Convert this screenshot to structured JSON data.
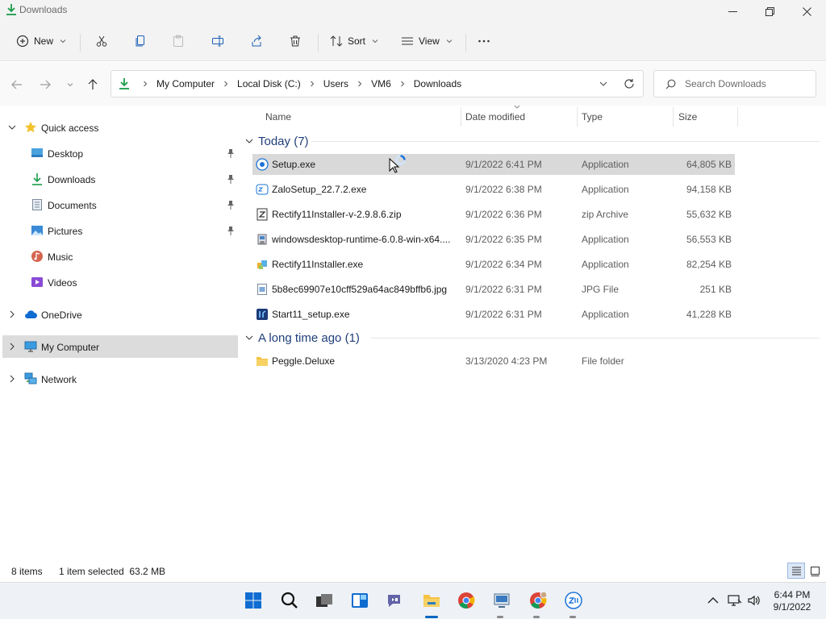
{
  "window": {
    "title": "Downloads"
  },
  "toolbar": {
    "new_label": "New",
    "sort_label": "Sort",
    "view_label": "View"
  },
  "address": {
    "crumbs": [
      "My Computer",
      "Local Disk (C:)",
      "Users",
      "VM6",
      "Downloads"
    ]
  },
  "search": {
    "placeholder": "Search Downloads"
  },
  "sidebar": {
    "quick_access": "Quick access",
    "items": [
      "Desktop",
      "Downloads",
      "Documents",
      "Pictures",
      "Music",
      "Videos"
    ],
    "onedrive": "OneDrive",
    "my_computer": "My Computer",
    "network": "Network"
  },
  "columns": {
    "name": "Name",
    "date": "Date modified",
    "type": "Type",
    "size": "Size"
  },
  "groups": {
    "today": "Today (7)",
    "long_ago": "A long time ago (1)"
  },
  "files": [
    {
      "name": "Setup.exe",
      "date": "9/1/2022 6:41 PM",
      "type": "Application",
      "size": "64,805 KB"
    },
    {
      "name": "ZaloSetup_22.7.2.exe",
      "date": "9/1/2022 6:38 PM",
      "type": "Application",
      "size": "94,158 KB"
    },
    {
      "name": "Rectify11Installer-v-2.9.8.6.zip",
      "date": "9/1/2022 6:36 PM",
      "type": "zip Archive",
      "size": "55,632 KB"
    },
    {
      "name": "windowsdesktop-runtime-6.0.8-win-x64....",
      "date": "9/1/2022 6:35 PM",
      "type": "Application",
      "size": "56,553 KB"
    },
    {
      "name": "Rectify11Installer.exe",
      "date": "9/1/2022 6:34 PM",
      "type": "Application",
      "size": "82,254 KB"
    },
    {
      "name": "5b8ec69907e10cff529a64ac849bffb6.jpg",
      "date": "9/1/2022 6:31 PM",
      "type": "JPG File",
      "size": "251 KB"
    },
    {
      "name": "Start11_setup.exe",
      "date": "9/1/2022 6:31 PM",
      "type": "Application",
      "size": "41,228 KB"
    }
  ],
  "old_files": [
    {
      "name": "Peggle.Deluxe",
      "date": "3/13/2020 4:23 PM",
      "type": "File folder",
      "size": ""
    }
  ],
  "status": {
    "items": "8 items",
    "selection": "1 item selected  63.2 MB"
  },
  "clock": {
    "time": "6:44 PM",
    "date": "9/1/2022"
  },
  "colors": {
    "accent": "#0067c0",
    "selected": "#d9d9d9",
    "folder": "#f5c342"
  }
}
